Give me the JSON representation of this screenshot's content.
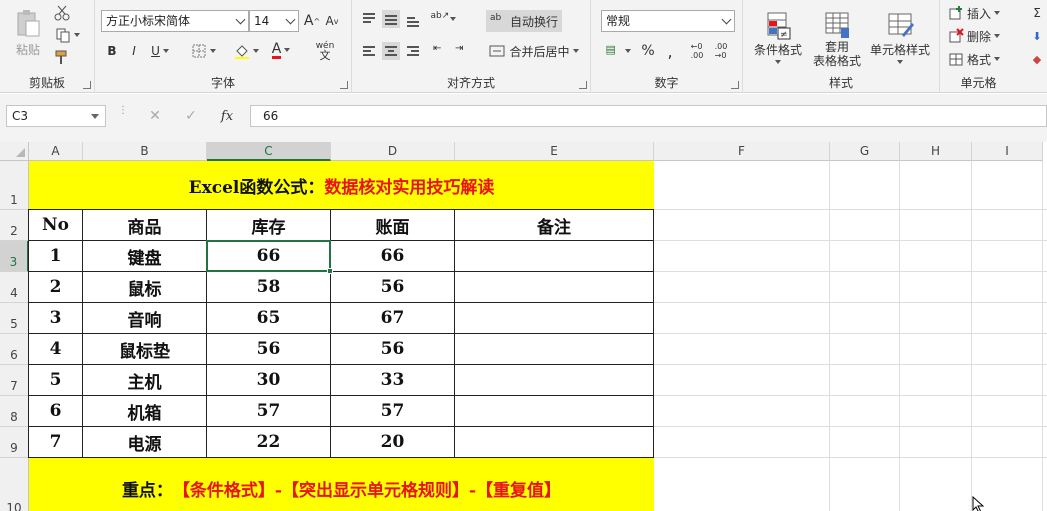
{
  "ribbon": {
    "clipboard": {
      "label": "剪贴板",
      "paste": "粘贴"
    },
    "font": {
      "label": "字体",
      "font_name": "方正小标宋简体",
      "font_size": "14",
      "bold": "B",
      "italic": "I",
      "underline": "U",
      "grow": "A",
      "shrink": "A",
      "font_color_letter": "A",
      "phonetic": "wén"
    },
    "alignment": {
      "label": "对齐方式",
      "wrap_text": "自动换行",
      "merge_center": "合并后居中"
    },
    "number": {
      "label": "数字",
      "format": "常规",
      "percent": "%",
      "comma": ","
    },
    "styles": {
      "label": "样式",
      "conditional": "条件格式",
      "table_line1": "套用",
      "table_line2": "表格格式",
      "cell_styles": "单元格样式"
    },
    "cells": {
      "label": "单元格",
      "insert": "插入",
      "delete": "删除",
      "format": "格式"
    }
  },
  "formula_bar": {
    "name_box": "C3",
    "fx": "fx",
    "value": "66"
  },
  "columns": [
    "A",
    "B",
    "C",
    "D",
    "E",
    "F",
    "G",
    "H",
    "I"
  ],
  "rows": [
    "1",
    "2",
    "3",
    "4",
    "5",
    "6",
    "7",
    "8",
    "9",
    "10"
  ],
  "sheet": {
    "title_black": "Excel函数公式：",
    "title_red": "数据核对实用技巧解读",
    "headers": [
      "No",
      "商品",
      "库存",
      "账面",
      "备注"
    ],
    "data": [
      [
        "1",
        "键盘",
        "66",
        "66",
        ""
      ],
      [
        "2",
        "鼠标",
        "58",
        "56",
        ""
      ],
      [
        "3",
        "音响",
        "65",
        "67",
        ""
      ],
      [
        "4",
        "鼠标垫",
        "56",
        "56",
        ""
      ],
      [
        "5",
        "主机",
        "30",
        "33",
        ""
      ],
      [
        "6",
        "机箱",
        "57",
        "57",
        ""
      ],
      [
        "7",
        "电源",
        "22",
        "20",
        ""
      ]
    ],
    "footer_black": "重点：",
    "footer_red": "【条件格式】-【突出显示单元格规则】-【重复值】"
  },
  "colors": {
    "accent": "#217346",
    "highlight": "#ffff00",
    "red_text": "#e8141b"
  }
}
